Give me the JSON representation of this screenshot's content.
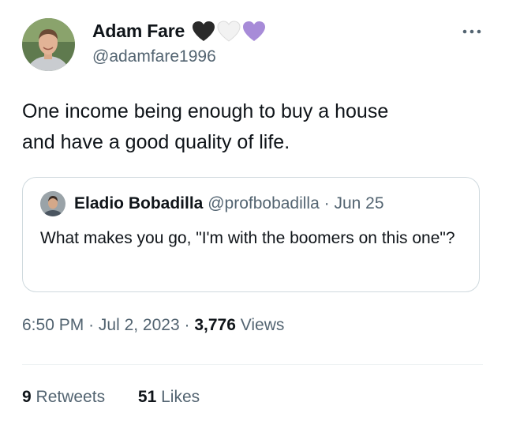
{
  "author": {
    "display_name": "Adam Fare",
    "handle": "@adamfare1996",
    "emoji_hearts": [
      "black-heart",
      "white-heart",
      "purple-heart"
    ]
  },
  "tweet": {
    "text": "One income being enough to buy a house\nand have a good quality of life."
  },
  "quoted_tweet": {
    "display_name": "Eladio Bobadilla",
    "handle": "@profbobadilla",
    "separator": "·",
    "date": "Jun 25",
    "text": "What makes you go, \"I'm with the boomers on this one\"?"
  },
  "meta": {
    "time": "6:50 PM",
    "separator": "·",
    "date": "Jul 2, 2023",
    "views_count": "3,776",
    "views_label": "Views"
  },
  "stats": {
    "retweets_count": "9",
    "retweets_label": "Retweets",
    "likes_count": "51",
    "likes_label": "Likes"
  },
  "colors": {
    "text_primary": "#0f1419",
    "text_secondary": "#536471",
    "border": "#cfd9de",
    "heart_purple": "#a78bd8"
  }
}
